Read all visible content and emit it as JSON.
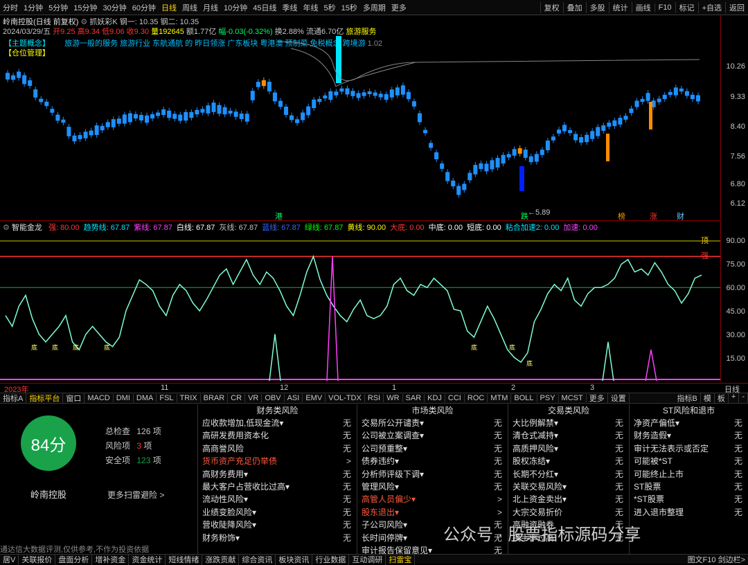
{
  "toolbar": {
    "periods": [
      "分时",
      "1分钟",
      "5分钟",
      "15分钟",
      "30分钟",
      "60分钟",
      "日线",
      "周线",
      "月线",
      "10分钟",
      "45日线",
      "季线",
      "年线",
      "5秒",
      "15秒",
      "多周期",
      "更多"
    ],
    "active_period": "日线",
    "right": [
      "复权",
      "叠加",
      "多股",
      "统计",
      "画线",
      "F10",
      "标记",
      "+自选",
      "返回"
    ]
  },
  "stock": {
    "title": "岭南控股(日线 前复权)",
    "indicator": "抓妖彩K 钢一: 10.35 钢二: 10.35",
    "date": "2024/03/29/五",
    "open": "开9.25",
    "high": "高9.34",
    "low": "低9.06",
    "close": "收9.30",
    "volume": "量192645",
    "amount": "额1.77亿",
    "change": "幅-0.03(-0.32%)",
    "turnover": "换2.88%",
    "float": "流通6.70亿",
    "sector": "旅游服务",
    "tag1": "【主题概念】",
    "tag2": "【仓位管理】",
    "concept_text": "旅游一般的服务 旅游行业 东航通航 的 昨日领涨 广东板块 粤港澳 预制菜 免税概念 跨境游",
    "concept_value": "1.02",
    "low_label": "5.89"
  },
  "price_axis": [
    "10.26",
    "9.33",
    "8.40",
    "7.56",
    "6.80",
    "6.12"
  ],
  "markers": [
    {
      "t": "港",
      "c": "#00ff66"
    },
    {
      "t": "跌",
      "c": "#00ff66"
    },
    {
      "t": "榜",
      "c": "#ff9900"
    },
    {
      "t": "涨",
      "c": "#ff3333"
    },
    {
      "t": "财",
      "c": "#66ccff"
    }
  ],
  "ind": {
    "name": "智能金龙",
    "values": [
      {
        "t": "强: 80.00",
        "c": "#ff3333"
      },
      {
        "t": "趋势线: 67.87",
        "c": "#00e5ff"
      },
      {
        "t": "紫线: 67.87",
        "c": "#ff40ff"
      },
      {
        "t": "白线: 67.87",
        "c": "#ffffff"
      },
      {
        "t": "灰线: 67.87",
        "c": "#c0c0c0"
      },
      {
        "t": "蓝线: 67.87",
        "c": "#3366ff"
      },
      {
        "t": "绿线: 67.87",
        "c": "#00ff00"
      },
      {
        "t": "黄线: 90.00",
        "c": "#ffff00"
      },
      {
        "t": "大底: 0.00",
        "c": "#ff3333"
      },
      {
        "t": "中底: 0.00",
        "c": "#ffffff"
      },
      {
        "t": "短底: 0.00",
        "c": "#ffffff"
      },
      {
        "t": "粘合加速2: 0.00",
        "c": "#00e5ff"
      },
      {
        "t": "加速: 0.00",
        "c": "#ff40ff"
      }
    ],
    "axis": [
      "90.00",
      "75.00",
      "60.00",
      "45.00",
      "30.00",
      "15.00"
    ],
    "label_top": "顶",
    "label_strong": "强",
    "bottom_label": "底",
    "mid_label": "底底底",
    "x_labels": [
      "2023年",
      "11",
      "12",
      "1",
      "2",
      "3"
    ],
    "corner": "日线"
  },
  "tabs": {
    "items": [
      "指标A",
      "指标平台",
      "窗口",
      "MACD",
      "DMI",
      "DMA",
      "FSL",
      "TRIX",
      "BRAR",
      "CR",
      "VR",
      "OBV",
      "ASI",
      "EMV",
      "VOL-TDX",
      "RSI",
      "WR",
      "SAR",
      "KDJ",
      "CCI",
      "ROC",
      "MTM",
      "BOLL",
      "PSY",
      "MCST",
      "更多",
      "设置"
    ],
    "active": "指标平台",
    "right": [
      "指标B",
      "模",
      "板",
      "+",
      "-"
    ]
  },
  "risk": {
    "score": "84分",
    "total_label": "总检查",
    "total": "126",
    "risk_label": "风险项",
    "risk": "3",
    "safe_label": "安全项",
    "safe": "123",
    "unit": "项",
    "name": "岭南控股",
    "more": "更多扫雷避险 >",
    "disclaimer": "通达信大数据评测,仅供参考,不作为投资依据",
    "columns": [
      {
        "title": "财务类风险",
        "rows": [
          {
            "n": "应收款增加,低现金流▾",
            "v": "无"
          },
          {
            "n": "高研发费用资本化",
            "v": "无"
          },
          {
            "n": "高商誉风险",
            "v": "无"
          },
          {
            "n": "货币资产充足仍举债",
            "v": ">",
            "w": true
          },
          {
            "n": "高财务费用▾",
            "v": "无"
          },
          {
            "n": "最大客户占营收比过高▾",
            "v": "无"
          },
          {
            "n": "流动性风险▾",
            "v": "无"
          },
          {
            "n": "业绩变脸风险▾",
            "v": "无"
          },
          {
            "n": "营收陡降风险▾",
            "v": "无"
          },
          {
            "n": "财务粉饰▾",
            "v": "无"
          }
        ]
      },
      {
        "title": "市场类风险",
        "rows": [
          {
            "n": "交易所公开谴责▾",
            "v": "无"
          },
          {
            "n": "公司被立案调查▾",
            "v": "无"
          },
          {
            "n": "公司预重整▾",
            "v": "无"
          },
          {
            "n": "债券违约▾",
            "v": "无"
          },
          {
            "n": "分析师评级下调▾",
            "v": "无"
          },
          {
            "n": "管理风险▾",
            "v": "无"
          },
          {
            "n": "高管人员偏少▾",
            "v": ">",
            "w": true
          },
          {
            "n": "股东退出▾",
            "v": ">",
            "w": true
          },
          {
            "n": "子公司风险▾",
            "v": "无"
          },
          {
            "n": "长时间停牌▾",
            "v": "无"
          },
          {
            "n": "审计报告保留意见▾",
            "v": "无"
          }
        ]
      },
      {
        "title": "交易类风险",
        "rows": [
          {
            "n": "大比例解禁▾",
            "v": "无"
          },
          {
            "n": "清仓式减持▾",
            "v": "无"
          },
          {
            "n": "高质押风险▾",
            "v": "无"
          },
          {
            "n": "股权冻结▾",
            "v": "无"
          },
          {
            "n": "长期不分红▾",
            "v": "无"
          },
          {
            "n": "关联交易风险▾",
            "v": "无"
          },
          {
            "n": "北上资金卖出▾",
            "v": "无"
          },
          {
            "n": "大宗交易折价",
            "v": "无"
          },
          {
            "n": "高融资融券",
            "v": "无"
          },
          {
            "n": "换手率过高",
            "v": "无"
          }
        ]
      },
      {
        "title": "ST风险和退市",
        "rows": [
          {
            "n": "净资产偏低▾",
            "v": "无"
          },
          {
            "n": "财务造假▾",
            "v": "无"
          },
          {
            "n": "审计无法表示或否定",
            "v": "无"
          },
          {
            "n": "可能被*ST",
            "v": "无"
          },
          {
            "n": "可能终止上市",
            "v": "无"
          },
          {
            "n": "ST股票",
            "v": "无"
          },
          {
            "n": "*ST股票",
            "v": "无"
          },
          {
            "n": "进入退市整理",
            "v": "无"
          }
        ]
      }
    ]
  },
  "bottom": {
    "items": [
      "居V",
      "关联报价",
      "盘面分析",
      "增补资金",
      "资金统计",
      "短线情绪",
      "涨跌贡献",
      "综合资讯",
      "板块资讯",
      "行业数据",
      "互动调研",
      "扫雷宝"
    ],
    "active": "扫雷宝",
    "right": "图文F10 剑边栏>"
  },
  "watermark": "公众号 · 股票指标源码分享",
  "colors": {
    "up": "#ff3333",
    "down": "#1e90ff",
    "safe": "#19a24a"
  }
}
